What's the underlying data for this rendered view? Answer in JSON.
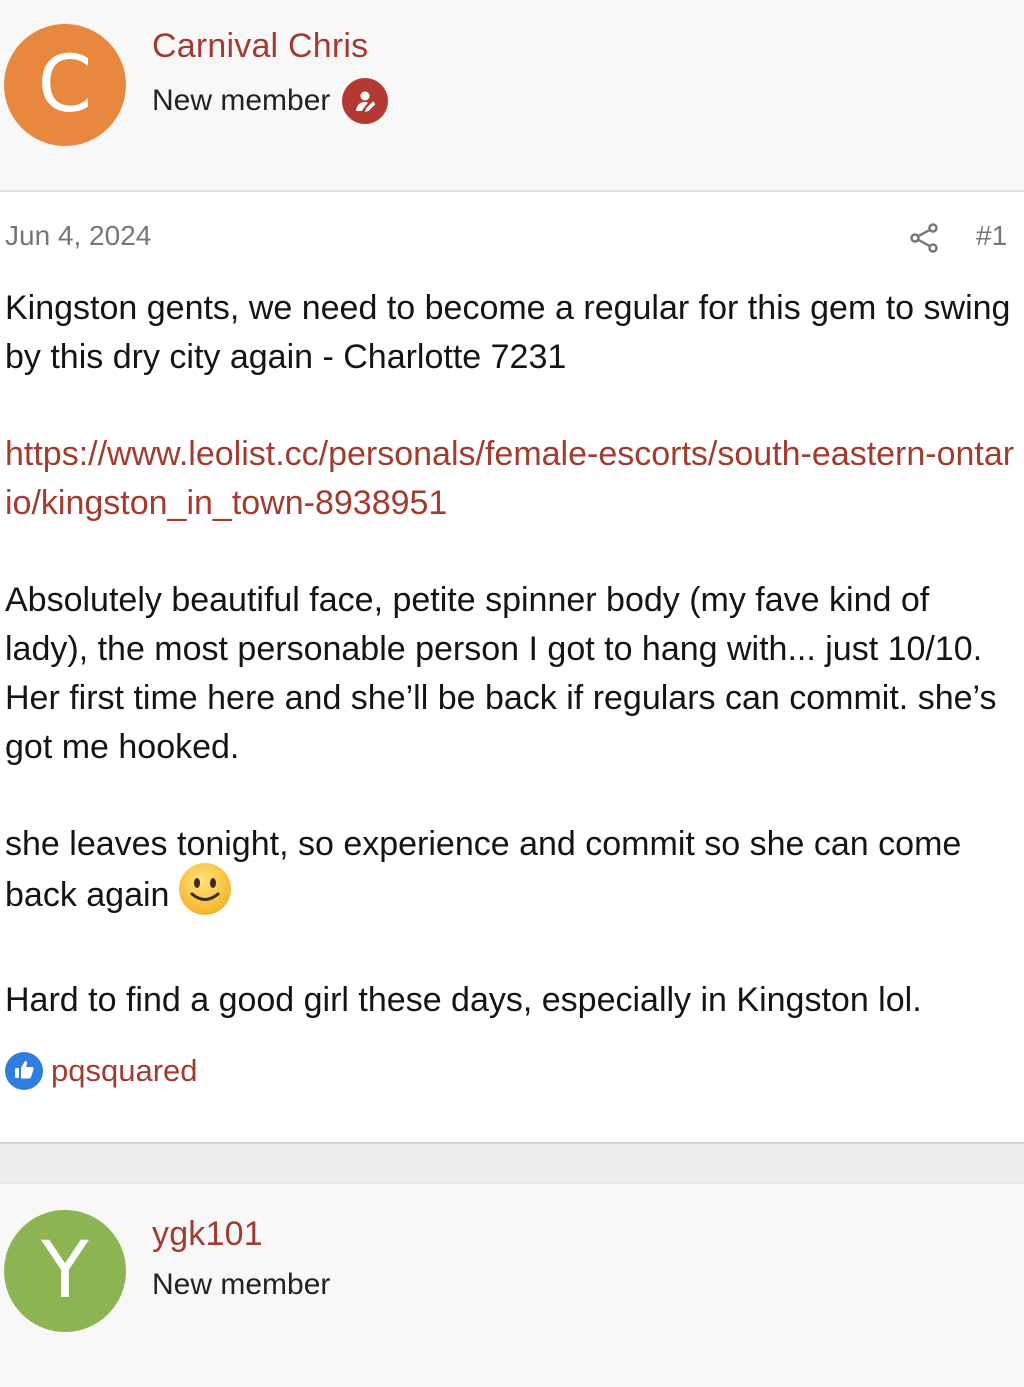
{
  "posts": [
    {
      "author": {
        "avatar_letter": "C",
        "avatar_color": "#e8883e",
        "name": "Carnival Chris",
        "title": "New member",
        "badge_icon": "person-edit-icon"
      },
      "date": "Jun 4, 2024",
      "post_number": "#1",
      "paragraphs": [
        "Kingston gents, we need to become a regular for this gem to swing by this dry city again - Charlotte 7231",
        "https://www.leolist.cc/personals/female-escorts/south-eastern-ontario/kingston_in_town-8938951",
        "Absolutely beautiful face, petite spinner body (my fave kind of lady), the most personable person I got to hang with... just 10/10. Her first time here and she’ll be back if regulars can commit. she’s got me hooked.",
        "she leaves tonight, so experience and commit so she can come back again",
        "Hard to find a good girl these days, especially in Kingston lol."
      ],
      "reaction": {
        "icon": "thumbs-up-icon",
        "users": "pqsquared"
      }
    },
    {
      "author": {
        "avatar_letter": "Y",
        "avatar_color": "#8db453",
        "name": "ygk101",
        "title": "New member"
      }
    }
  ],
  "colors": {
    "link": "#a33c30",
    "like": "#2f7de1",
    "muted": "#777777"
  }
}
